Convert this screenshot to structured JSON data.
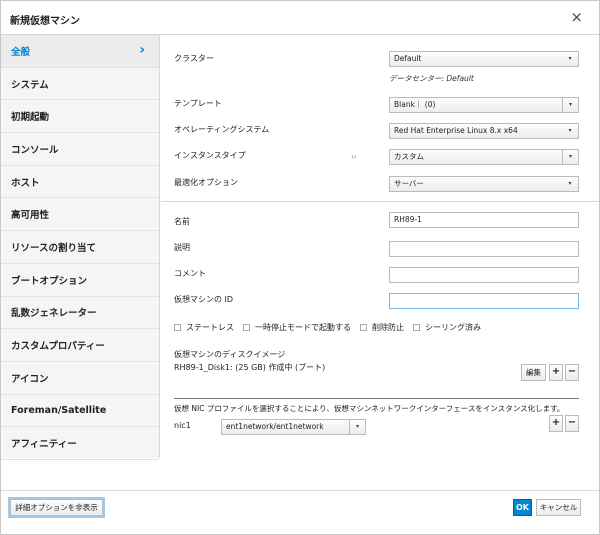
{
  "dialog": {
    "title": "新規仮想マシン",
    "close": "×"
  },
  "sidebar": {
    "items": [
      {
        "label": "全般"
      },
      {
        "label": "システム"
      },
      {
        "label": "初期起動"
      },
      {
        "label": "コンソール"
      },
      {
        "label": "ホスト"
      },
      {
        "label": "高可用性"
      },
      {
        "label": "リソースの割り当て"
      },
      {
        "label": "ブートオプション"
      },
      {
        "label": "乱数ジェネレーター"
      },
      {
        "label": "カスタムプロパティー"
      },
      {
        "label": "アイコン"
      },
      {
        "label": "Foreman/Satellite"
      },
      {
        "label": "アフィニティー"
      }
    ],
    "active_indicator": "›"
  },
  "general": {
    "cluster": {
      "label": "クラスター",
      "value": "Default",
      "hint": "データセンター: Default"
    },
    "template": {
      "label": "テンプレート",
      "value": "Blank｜ (0)"
    },
    "os": {
      "label": "オペレーティングシステム",
      "value": "Red Hat Enterprise Linux 8.x x64"
    },
    "instance_type": {
      "label": "インスタンスタイプ",
      "value": "カスタム"
    },
    "optimization": {
      "label": "最適化オプション",
      "value": "サーバー"
    },
    "name": {
      "label": "名前",
      "value": "RH89-1"
    },
    "description": {
      "label": "説明",
      "value": ""
    },
    "comment": {
      "label": "コメント",
      "value": ""
    },
    "vm_id": {
      "label": "仮想マシンの ID",
      "value": ""
    },
    "checkboxes": {
      "stateless": "ステートレス",
      "start_paused": "一時停止モードで起動する",
      "delete_protection": "削除防止",
      "sealed": "シーリング済み"
    },
    "disk": {
      "label": "仮想マシンのディスクイメージ",
      "entry": "RH89-1_Disk1: (25 GB) 作成中 (ブート)",
      "edit": "編集",
      "add": "+",
      "remove": "−"
    },
    "nic": {
      "description": "仮想 NIC プロファイルを選択することにより、仮想マシンネットワークインターフェースをインスタンス化します。",
      "label": "nic1",
      "value": "ent1network/ent1network",
      "add": "+",
      "remove": "−"
    }
  },
  "footer": {
    "advanced": "詳細オプションを非表示",
    "ok": "OK",
    "cancel": "キャンセル"
  },
  "icons": {
    "caret": "▾",
    "swap": "‹›"
  },
  "colors": {
    "accent": "#0088ce"
  }
}
